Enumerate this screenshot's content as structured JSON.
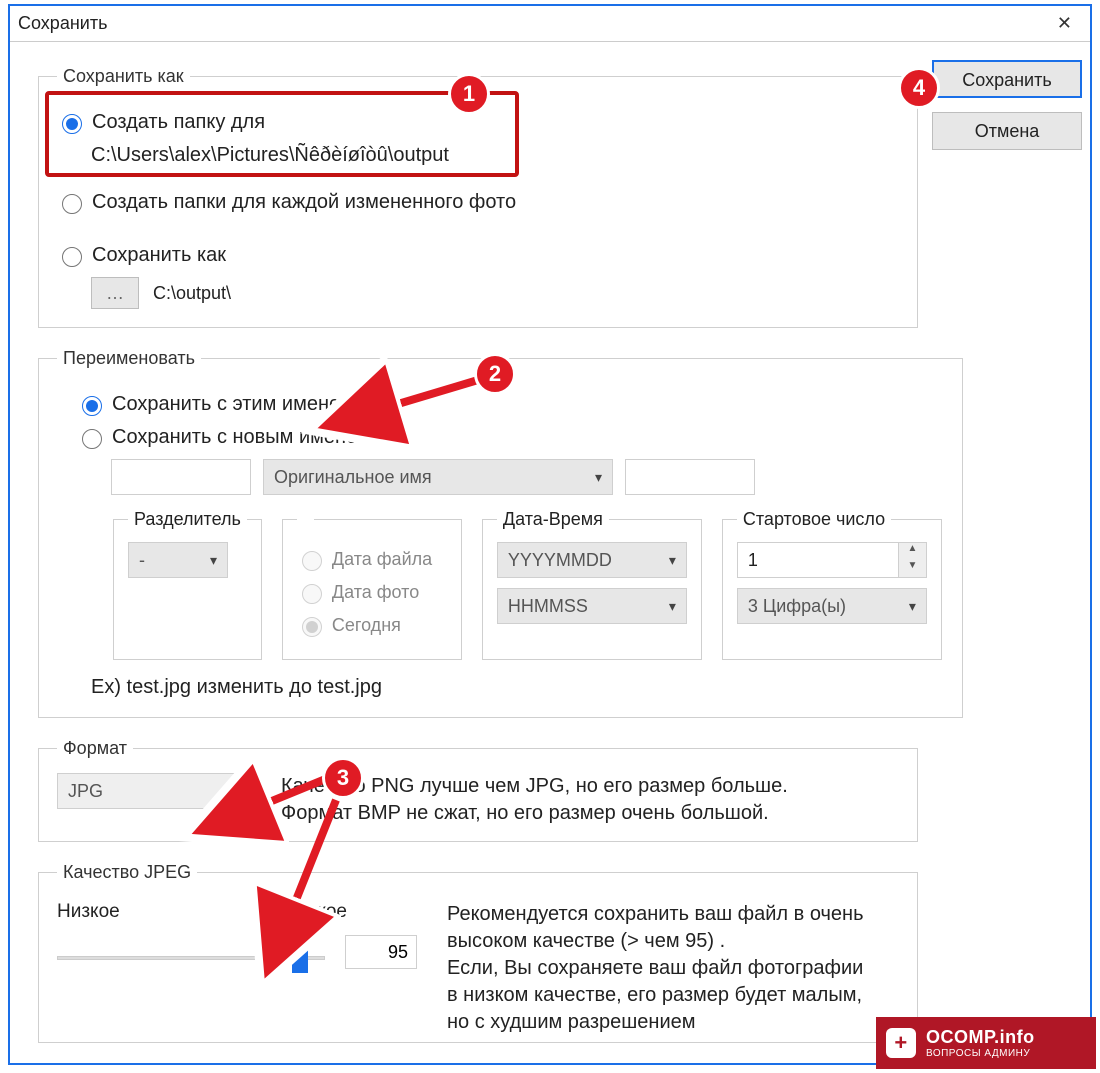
{
  "window": {
    "title": "Сохранить"
  },
  "buttons": {
    "save": "Сохранить",
    "cancel": "Отмена"
  },
  "save_as": {
    "legend": "Сохранить как",
    "opt1_label": "Создать папку для",
    "opt1_path": "C:\\Users\\alex\\Pictures\\Ñêðèíøîòû\\output",
    "opt2_label": "Создать папки для каждой измененного фото",
    "opt3_label": "Сохранить как",
    "opt3_path": "C:\\output\\",
    "browse": "…"
  },
  "rename": {
    "legend": "Переименовать",
    "opt1": "Сохранить с этим именем",
    "opt2": "Сохранить с новым именем",
    "name_select": "Оригинальное имя",
    "separator": {
      "legend": "Разделитель",
      "value": "-"
    },
    "datetime": {
      "legend": "Дата-Время",
      "opt_file": "Дата файла",
      "opt_photo": "Дата фото",
      "opt_today": "Сегодня",
      "fmt_date": "YYYYMMDD",
      "fmt_time": "HHMMSS"
    },
    "start_num": {
      "legend": "Стартовое число",
      "value": "1",
      "digits": "3 Цифра(ы)"
    },
    "example": "Ex) test.jpg изменить до test.jpg"
  },
  "format": {
    "legend": "Формат",
    "value": "JPG",
    "hint": "Качество PNG лучше чем JPG, но его размер больше. Формат BMP не сжат, но его размер очень большой."
  },
  "quality": {
    "legend": "Качество JPEG",
    "low": "Низкое",
    "high": "Высокое",
    "value": "95",
    "hint": "Рекомендуется сохранить ваш файл в очень высоком качестве (> чем 95) .\nЕсли, Вы сохраняете ваш файл фотографии в низком качестве, его размер будет малым, но с худшим разрешением"
  },
  "watermark": {
    "line1": "OCOMP.info",
    "line2": "ВОПРОСЫ АДМИНУ"
  },
  "badges": {
    "b1": "1",
    "b2": "2",
    "b3": "3",
    "b4": "4"
  }
}
